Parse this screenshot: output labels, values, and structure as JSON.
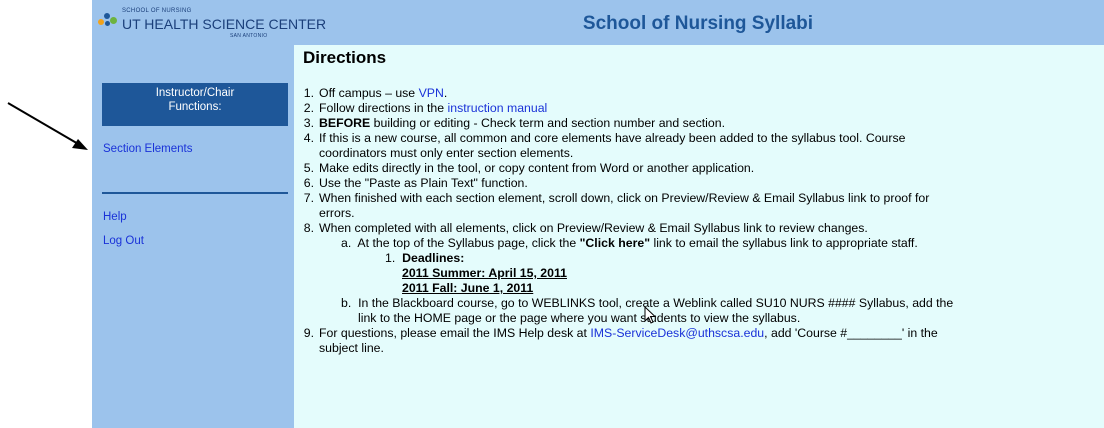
{
  "header": {
    "logo_line1": "SCHOOL OF NURSING",
    "logo_line2": "UT HEALTH SCIENCE CENTER",
    "logo_line3": "SAN ANTONIO",
    "title": "School of Nursing Syllabi"
  },
  "sidebar": {
    "box_line1": "Instructor/Chair",
    "box_line2": "Functions:",
    "section_elements": "Section Elements",
    "help": "Help",
    "logout": "Log Out"
  },
  "main": {
    "heading": "Directions",
    "items": {
      "i1_num": "1.",
      "i1_pre": "Off campus – use ",
      "i1_link": "VPN",
      "i2_num": "2.",
      "i2_pre": "Follow directions in the ",
      "i2_link": "instruction manual",
      "i3_num": "3.",
      "i3_bold": "BEFORE",
      "i3_post": " building or editing - Check term and section number and section.",
      "i4_num": "4.",
      "i4_line1": "If this is a new course, all common and core elements have already been added to the syllabus tool. Course",
      "i4_line2": "coordinators must only enter section elements.",
      "i5_num": "5.",
      "i5": "Make edits directly in the tool, or copy content from Word or another application.",
      "i6_num": "6.",
      "i6": "Use the \"Paste as Plain Text\" function.",
      "i7_num": "7.",
      "i7_line1": "When finished with each section element, scroll down, click on Preview/Review & Email Syllabus link to proof for",
      "i7_line2": "errors.",
      "i8_num": "8.",
      "i8": "When completed with all elements, click on Preview/Review & Email Syllabus link to review changes.",
      "a_num": "a.",
      "a_pre": "At the top of the Syllabus page, click the ",
      "a_bold": "\"Click here\"",
      "a_post": " link to email the syllabus link to appropriate staff.",
      "d_num": "1.",
      "d_label": "Deadlines:",
      "d_summer": "2011 Summer: April 15, 2011",
      "d_fall": "2011 Fall: June 1, 2011",
      "b_num": "b.",
      "b_line1": "In the Blackboard course, go to WEBLINKS tool, create a Weblink called SU10 NURS #### Syllabus, add the",
      "b_line2": "link to the HOME page or the page where you want students to view the syllabus.",
      "i9_num": "9.",
      "i9_pre": "For questions, please email the IMS Help desk at ",
      "i9_link": "IMS-ServiceDesk@uthscsa.edu",
      "i9_post": ", add 'Course #________' in the",
      "i9_line2": "subject line."
    }
  },
  "colors": {
    "header_bg": "#9cc3ec",
    "nav_box": "#1e5799",
    "main_bg": "#e4fcfc",
    "link": "#1a32d8"
  }
}
